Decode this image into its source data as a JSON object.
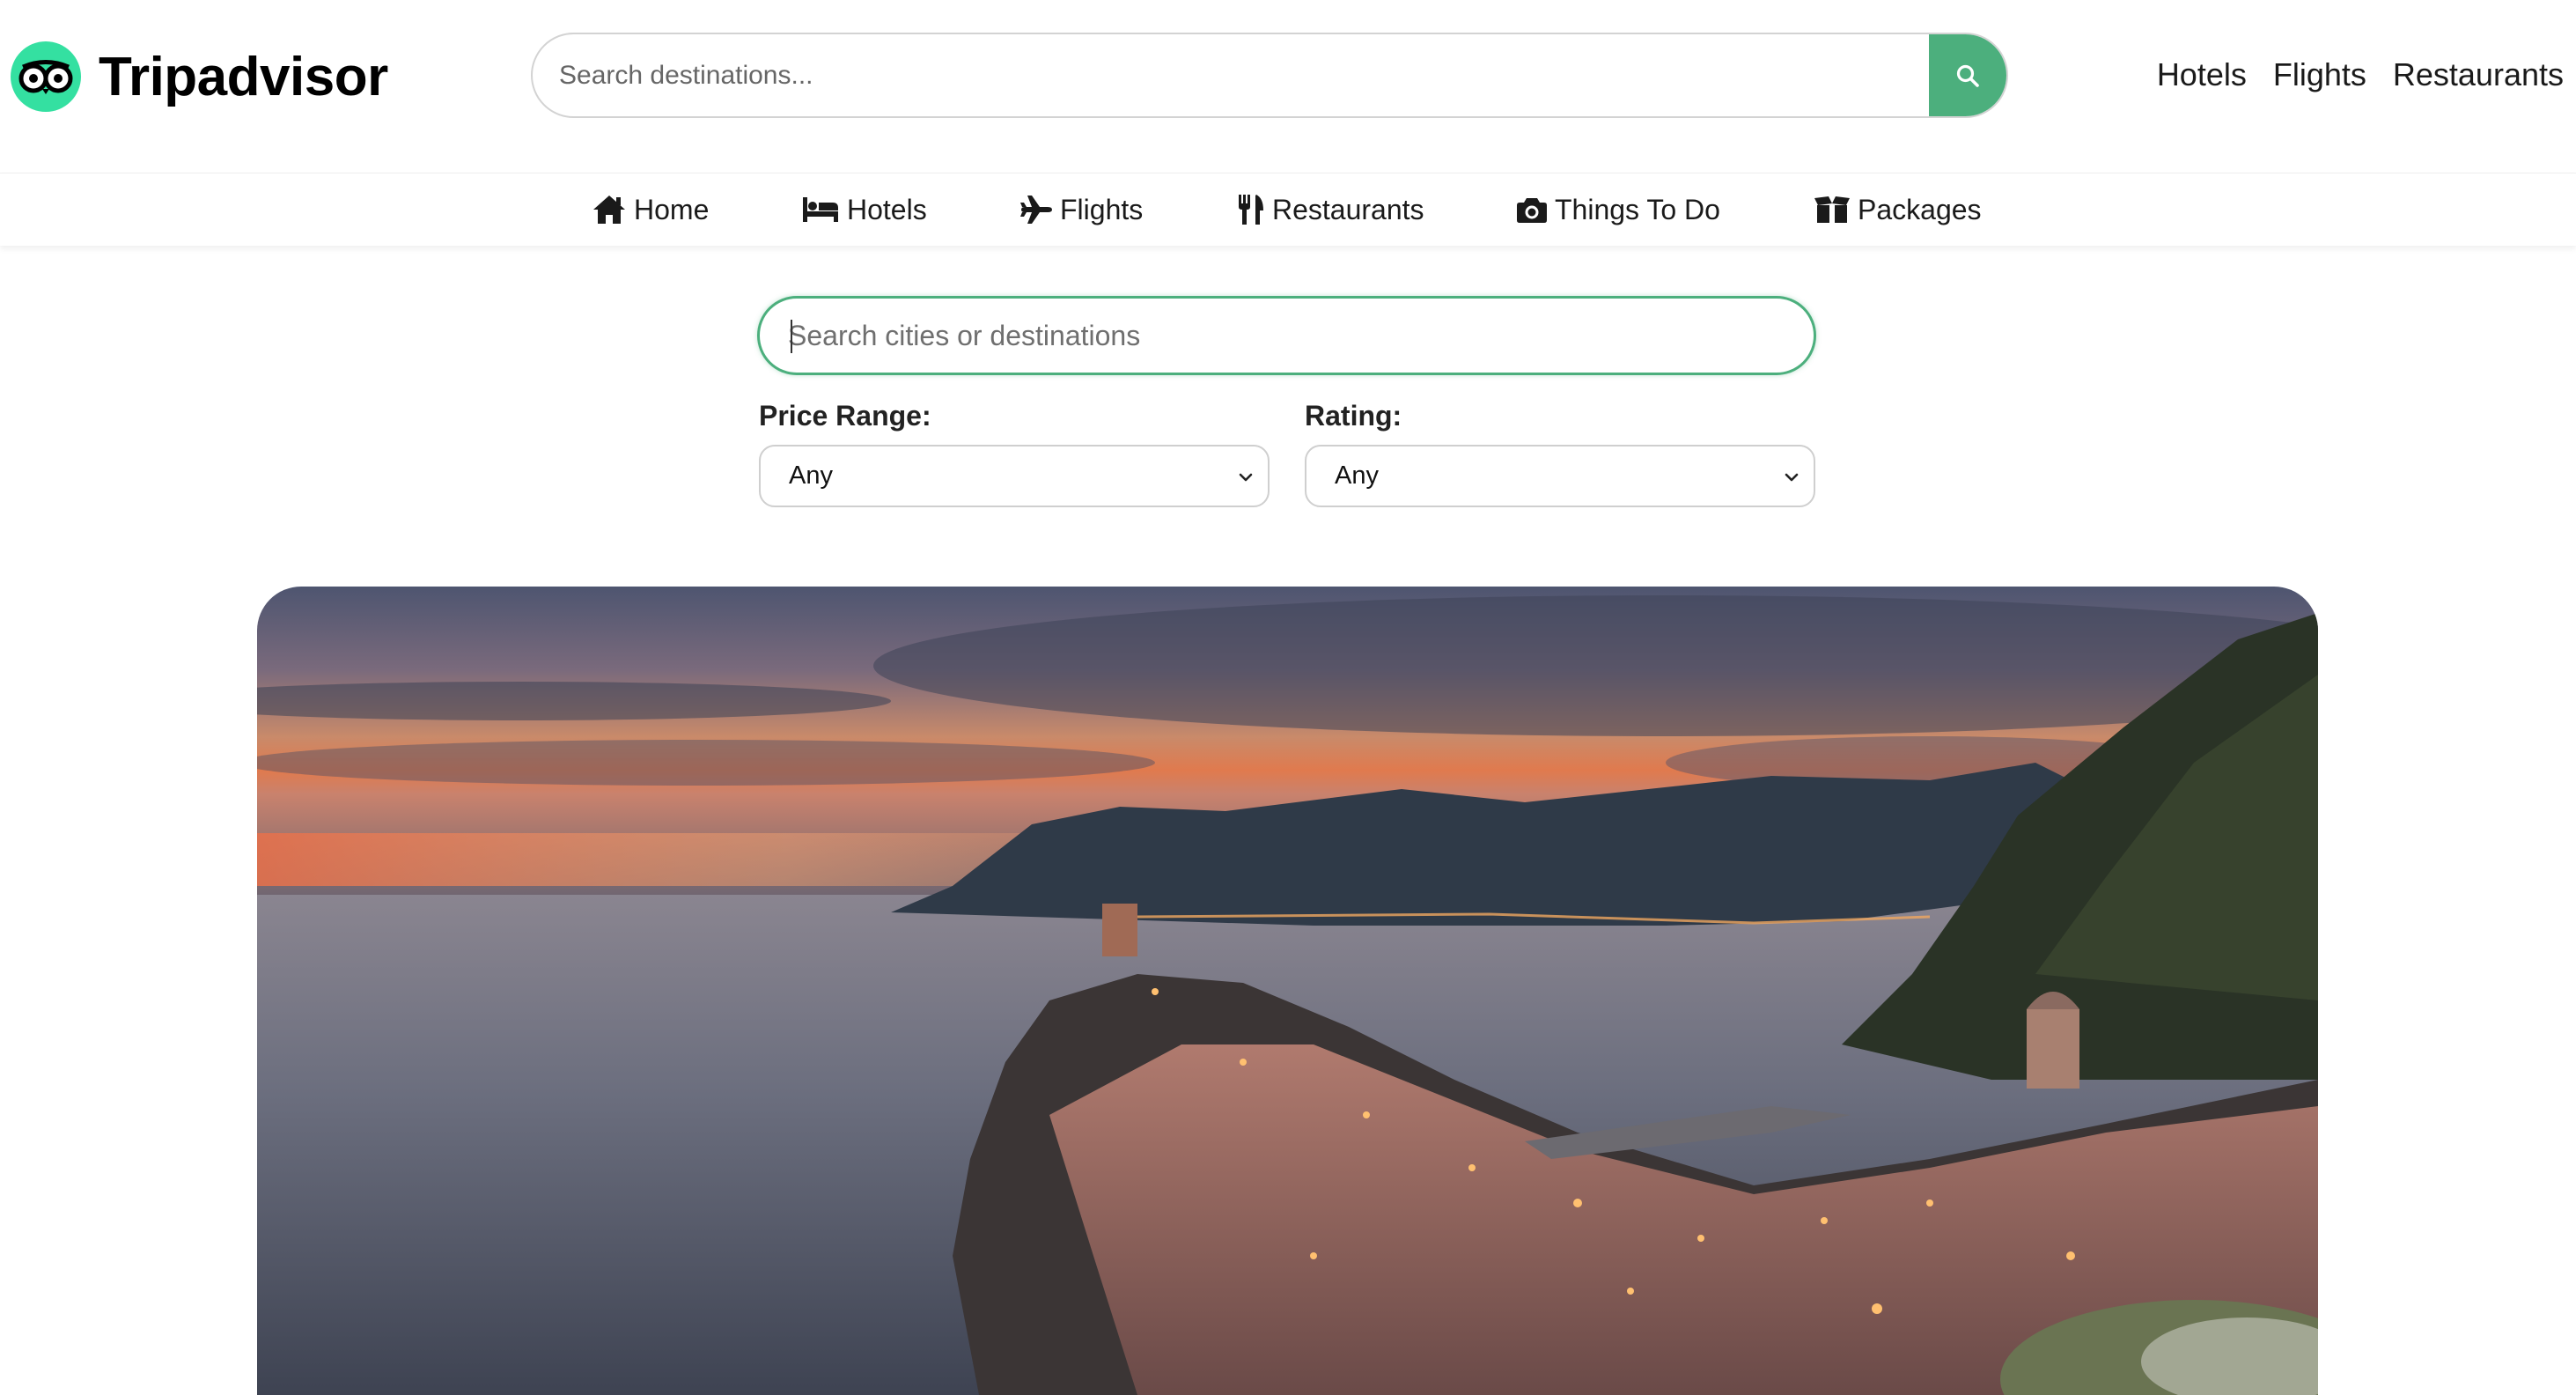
{
  "brand": {
    "name": "Tripadvisor",
    "logo_color": "#34e0a1"
  },
  "header": {
    "search_placeholder": "Search destinations...",
    "search_button_icon": "search-icon",
    "accent_color": "#4caf7d",
    "links": [
      "Hotels",
      "Flights",
      "Restaurants"
    ]
  },
  "nav": {
    "items": [
      {
        "label": "Home",
        "icon": "home-icon"
      },
      {
        "label": "Hotels",
        "icon": "bed-icon"
      },
      {
        "label": "Flights",
        "icon": "plane-icon"
      },
      {
        "label": "Restaurants",
        "icon": "utensils-icon"
      },
      {
        "label": "Things To Do",
        "icon": "camera-icon"
      },
      {
        "label": "Packages",
        "icon": "box-icon"
      }
    ]
  },
  "filters": {
    "search_placeholder": "Search cities or destinations",
    "price_label": "Price Range:",
    "price_value": "Any",
    "rating_label": "Rating:",
    "rating_value": "Any"
  },
  "hero": {
    "image": "coastal-village-sunset-photo"
  }
}
